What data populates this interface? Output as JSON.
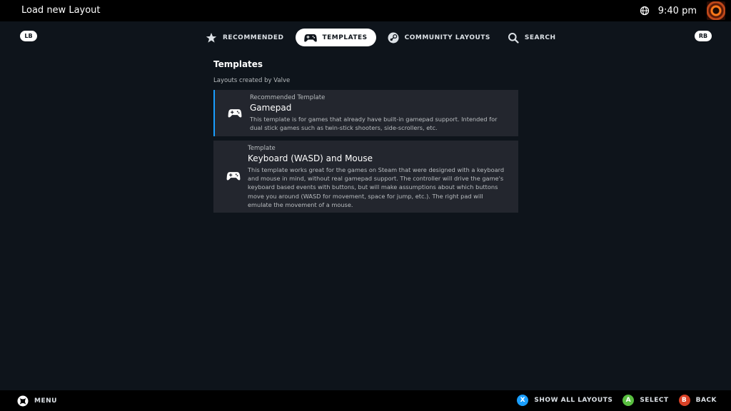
{
  "header": {
    "title": "Load new Layout",
    "time": "9:40 pm"
  },
  "shoulders": {
    "left": "LB",
    "right": "RB"
  },
  "tabs": [
    {
      "label": "RECOMMENDED",
      "icon": "star-icon"
    },
    {
      "label": "TEMPLATES",
      "icon": "gamepad-icon",
      "active": true
    },
    {
      "label": "COMMUNITY LAYOUTS",
      "icon": "steam-icon"
    },
    {
      "label": "SEARCH",
      "icon": "search-icon"
    }
  ],
  "section": {
    "title": "Templates",
    "subtitle": "Layouts created by Valve"
  },
  "templates": [
    {
      "kind": "Recommended Template",
      "name": "Gamepad",
      "description": "This template is for games that already have built-in gamepad support. Intended for dual stick games such as twin-stick shooters, side-scrollers, etc."
    },
    {
      "kind": "Template",
      "name": "Keyboard (WASD) and Mouse",
      "description": "This template works great for the games on Steam that were designed with a keyboard and mouse in mind, without real gamepad support. The controller will drive the game's keyboard based events with buttons, but will make assumptions about which buttons move you around (WASD for movement, space for jump, etc.). The right pad will emulate the movement of a mouse."
    }
  ],
  "footer": {
    "menu_label": "MENU",
    "actions": [
      {
        "button": "X",
        "label": "SHOW ALL LAYOUTS",
        "color": "#1a9fff"
      },
      {
        "button": "A",
        "label": "SELECT",
        "color": "#59bf40"
      },
      {
        "button": "B",
        "label": "BACK",
        "color": "#d94126"
      }
    ]
  },
  "colors": {
    "background": "#0e141b",
    "card": "#23262e",
    "accent": "#1a9fff"
  }
}
